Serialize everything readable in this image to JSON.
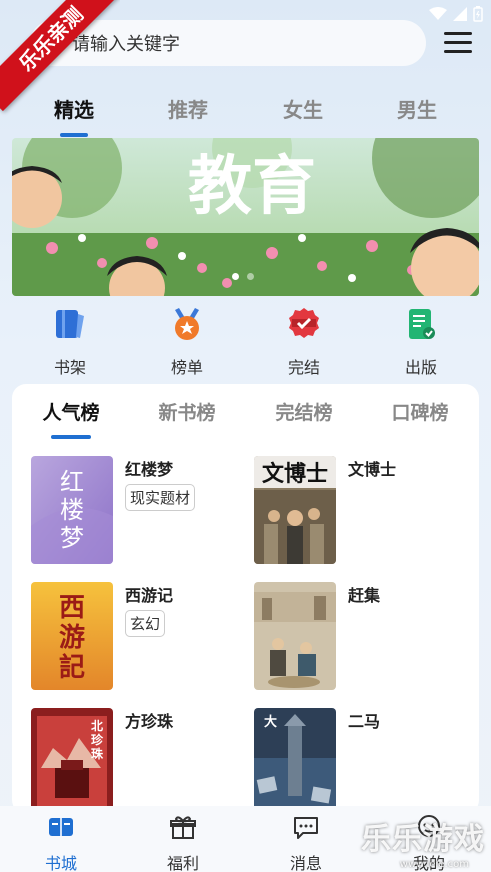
{
  "watermark_ribbon": "乐乐亲测",
  "search": {
    "placeholder": "请输入关键字"
  },
  "top_tabs": [
    {
      "label": "精选",
      "active": true
    },
    {
      "label": "推荐",
      "active": false
    },
    {
      "label": "女生",
      "active": false
    },
    {
      "label": "男生",
      "active": false
    }
  ],
  "banner": {
    "headline": "教育",
    "slide_count": 2,
    "current_slide": 1
  },
  "quick_nav": [
    {
      "label": "书架",
      "icon": "bookshelf-icon"
    },
    {
      "label": "榜单",
      "icon": "medal-icon"
    },
    {
      "label": "完结",
      "icon": "finished-badge-icon"
    },
    {
      "label": "出版",
      "icon": "publish-doc-icon"
    }
  ],
  "ranking_tabs": [
    {
      "label": "人气榜",
      "active": true
    },
    {
      "label": "新书榜",
      "active": false
    },
    {
      "label": "完结榜",
      "active": false
    },
    {
      "label": "口碑榜",
      "active": false
    }
  ],
  "books": [
    {
      "title": "红楼梦",
      "tag": "现实题材",
      "cover_text": "红楼梦"
    },
    {
      "title": "文博士",
      "tag": "",
      "cover_text": "文博士"
    },
    {
      "title": "西游记",
      "tag": "玄幻",
      "cover_text": "西游記"
    },
    {
      "title": "赶集",
      "tag": "",
      "cover_text": ""
    },
    {
      "title": "方珍珠",
      "tag": "",
      "cover_text": "北珍珠"
    },
    {
      "title": "二马",
      "tag": "",
      "cover_text": "大"
    }
  ],
  "bottom_nav": [
    {
      "label": "书城",
      "icon": "book-open-icon",
      "active": true
    },
    {
      "label": "福利",
      "icon": "gift-icon",
      "active": false
    },
    {
      "label": "消息",
      "icon": "message-icon",
      "active": false
    },
    {
      "label": "我的",
      "icon": "profile-icon",
      "active": false
    }
  ],
  "watermark": {
    "text": "乐乐游戏",
    "sub": "www.lele.com"
  },
  "colors": {
    "accent": "#1f6fd1",
    "ribbon": "#d0111b"
  }
}
